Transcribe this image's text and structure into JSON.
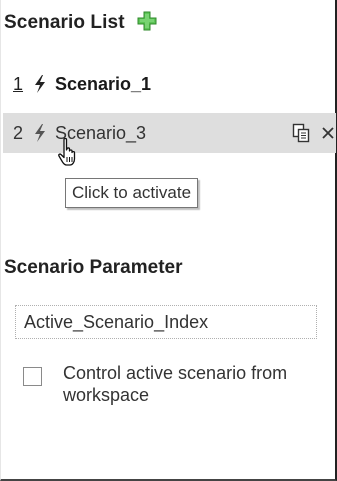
{
  "scenario_list": {
    "title": "Scenario List",
    "add_icon": "plus-icon",
    "add_icon_color": "#4cb848",
    "items": [
      {
        "index": "1",
        "name": "Scenario_1",
        "active": true,
        "icon": "lightning-bolt-icon"
      },
      {
        "index": "2",
        "name": "Scenario_3",
        "active": false,
        "icon": "lightning-bolt-icon",
        "actions": [
          "copy-icon",
          "close-icon"
        ]
      }
    ],
    "hover_row_color": "#dedede"
  },
  "tooltip": {
    "text": "Click to activate"
  },
  "scenario_parameter": {
    "title": "Scenario Parameter",
    "input_value": "Active_Scenario_Index",
    "checkbox": {
      "checked": false,
      "label": "Control active scenario from workspace"
    }
  }
}
